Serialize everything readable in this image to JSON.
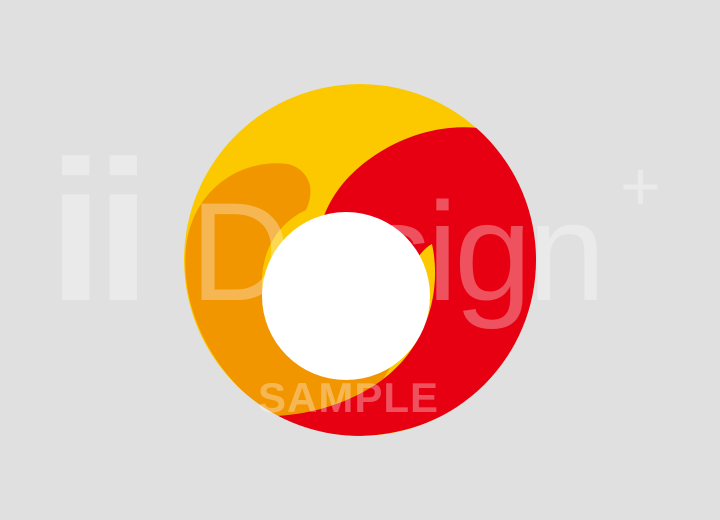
{
  "logo": {
    "colors": {
      "background": "#e0e0e0",
      "yellow": "#fcc800",
      "orange": "#f29600",
      "red": "#e60012",
      "center_hole": "#ffffff"
    }
  },
  "watermark": {
    "brand_prefix": "ii",
    "brand_word": "Design",
    "brand_plus": "+",
    "sample_label": "SAMPLE",
    "color": "#ffffff"
  }
}
